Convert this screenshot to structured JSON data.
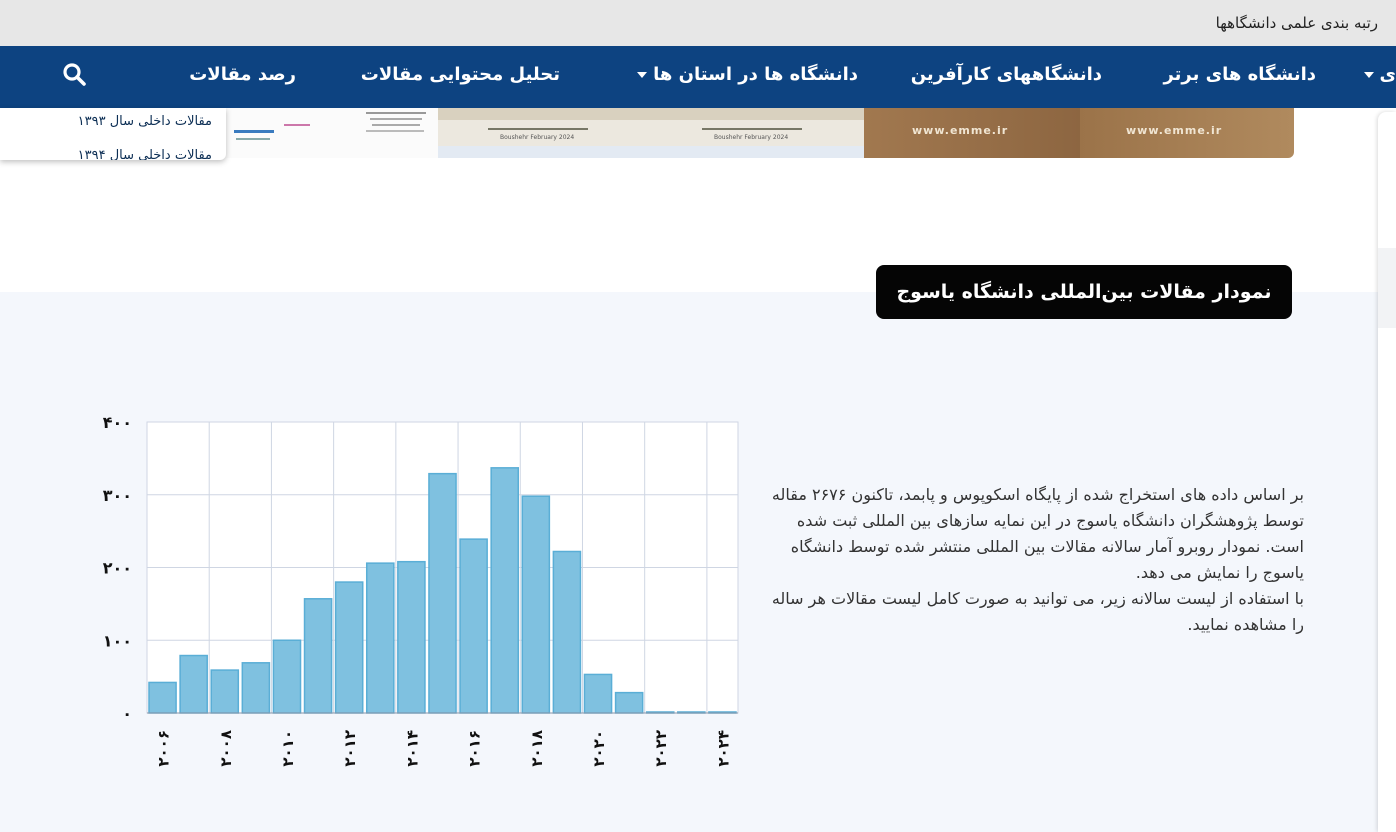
{
  "topbar": {
    "title": "رتبه بندی علمی دانشگاهها"
  },
  "nav": {
    "items": [
      {
        "label": "ی",
        "dropdown": true
      },
      {
        "label": "دانشگاه های برتر",
        "dropdown": false
      },
      {
        "label": "دانشگاههای کارآفرین",
        "dropdown": false
      },
      {
        "label": "دانشگاه ها در استان ها",
        "dropdown": true
      },
      {
        "label": "تحلیل محتوایی مقالات",
        "dropdown": false
      },
      {
        "label": "رصد مقالات",
        "dropdown": false
      }
    ],
    "search_icon": "search-icon"
  },
  "dropdown": {
    "items": [
      "مقالات داخلی سال ۱۳۹۳",
      "مقالات داخلی سال ۱۳۹۴"
    ]
  },
  "banners": [
    {
      "text": "www.emme.ir"
    },
    {
      "text": "www.emme.ir"
    },
    {
      "text": "Boushehr February 2024"
    },
    {
      "text": "Boushehr February 2024"
    }
  ],
  "section": {
    "heading": "نمودار مقالات بین‌المللی دانشگاه یاسوج",
    "paragraph1": "بر اساس داده های استخراج شده از پایگاه اسکوپوس و پابمد، تاکنون ۲۶۷۶ مقاله توسط پژوهشگران دانشگاه یاسوج در این نمایه سازهای بین المللی ثبت شده است. نمودار روبرو آمار سالانه مقالات بین المللی منتشر شده توسط دانشگاه یاسوج را نمایش می دهد.",
    "paragraph2": "با استفاده از لیست سالانه زیر، می توانید به صورت کامل لیست مقالات هر ساله را مشاهده نمایید."
  },
  "colors": {
    "nav": "#0d4381",
    "bar": "#7fc1e0",
    "bar_border": "#5aaed6",
    "section_bg": "#f4f7fc"
  },
  "chart_data": {
    "type": "bar",
    "categories": [
      "2006",
      "2007",
      "2008",
      "2009",
      "2010",
      "2011",
      "2012",
      "2013",
      "2014",
      "2015",
      "2016",
      "2017",
      "2018",
      "2019",
      "2020",
      "2021",
      "2022",
      "2023",
      "2024"
    ],
    "values": [
      42,
      79,
      59,
      69,
      100,
      157,
      180,
      206,
      208,
      329,
      239,
      337,
      298,
      222,
      53,
      28,
      1,
      1,
      1
    ],
    "yticks": [
      "۰",
      "۱۰۰",
      "۲۰۰",
      "۳۰۰",
      "۴۰۰"
    ],
    "xticks": [
      "۲۰۰۶",
      "۲۰۰۸",
      "۲۰۱۰",
      "۲۰۱۲",
      "۲۰۱۴",
      "۲۰۱۶",
      "۲۰۱۸",
      "۲۰۲۰",
      "۲۰۲۲",
      "۲۰۲۴"
    ],
    "ylim": [
      0,
      400
    ],
    "grid": true,
    "title": "",
    "xlabel": "",
    "ylabel": ""
  }
}
